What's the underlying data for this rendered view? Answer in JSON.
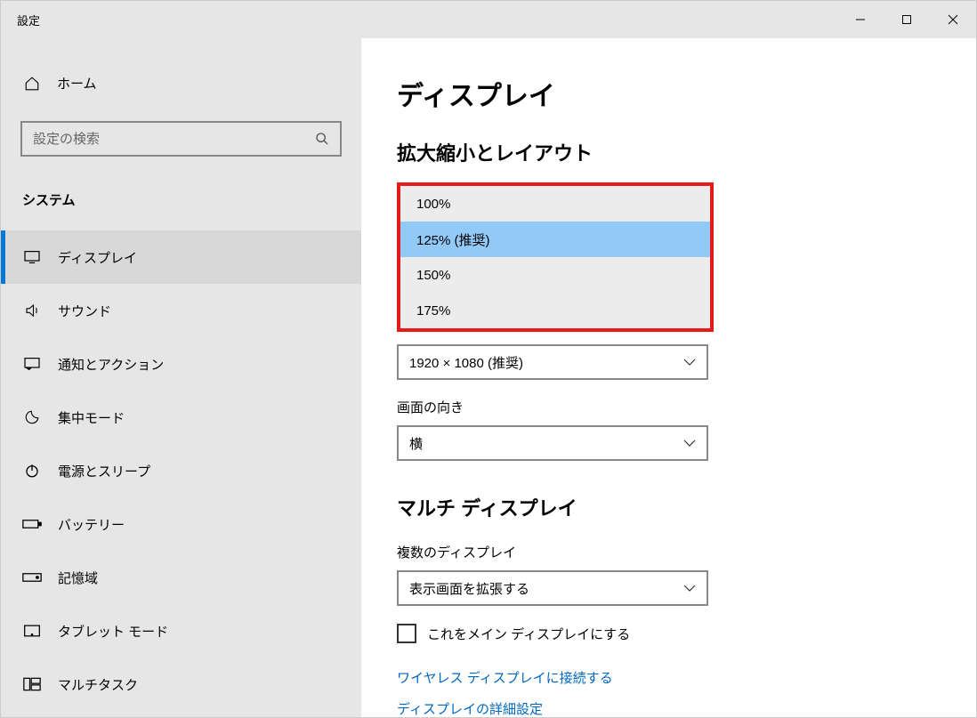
{
  "window": {
    "title": "設定"
  },
  "sidebar": {
    "home": "ホーム",
    "search_placeholder": "設定の検索",
    "category": "システム",
    "items": [
      {
        "label": "ディスプレイ",
        "active": true
      },
      {
        "label": "サウンド"
      },
      {
        "label": "通知とアクション"
      },
      {
        "label": "集中モード"
      },
      {
        "label": "電源とスリープ"
      },
      {
        "label": "バッテリー"
      },
      {
        "label": "記憶域"
      },
      {
        "label": "タブレット モード"
      },
      {
        "label": "マルチタスク"
      }
    ]
  },
  "main": {
    "title": "ディスプレイ",
    "scale_section": "拡大縮小とレイアウト",
    "scale_options": [
      "100%",
      "125% (推奨)",
      "150%",
      "175%"
    ],
    "scale_selected": "125% (推奨)",
    "resolution": "1920 × 1080 (推奨)",
    "orientation_label": "画面の向き",
    "orientation_value": "横",
    "multi_title": "マルチ ディスプレイ",
    "multi_label": "複数のディスプレイ",
    "multi_value": "表示画面を拡張する",
    "checkbox_label": "これをメイン ディスプレイにする",
    "link1": "ワイヤレス ディスプレイに接続する",
    "link2": "ディスプレイの詳細設定"
  }
}
